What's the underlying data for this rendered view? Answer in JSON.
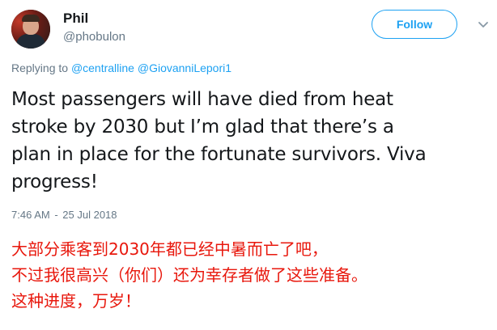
{
  "author": {
    "display_name": "Phil",
    "handle": "@phobulon"
  },
  "follow_button": {
    "label": "Follow"
  },
  "reply": {
    "prefix": "Replying to",
    "mentions": [
      "@centralline",
      "@GiovanniLepori1"
    ]
  },
  "tweet": {
    "lines": [
      "Most passengers will have died from heat",
      "stroke by 2030 but I’m glad that there’s a",
      "plan in place for the fortunate survivors. Viva",
      "progress!"
    ]
  },
  "timestamp": {
    "time": "7:46 AM",
    "separator": "-",
    "date": "25 Jul 2018"
  },
  "translation": {
    "lines": [
      "大部分乘客到2030年都已经中暑而亡了吧，",
      "不过我很高兴（你们）还为幸存者做了这些准备。",
      "这种进度，万岁！"
    ]
  },
  "colors": {
    "accent": "#1da1f2",
    "text": "#14171a",
    "muted": "#657786",
    "translation_red": "#e8170c"
  },
  "icons": {
    "more": "chevron-down-icon"
  }
}
